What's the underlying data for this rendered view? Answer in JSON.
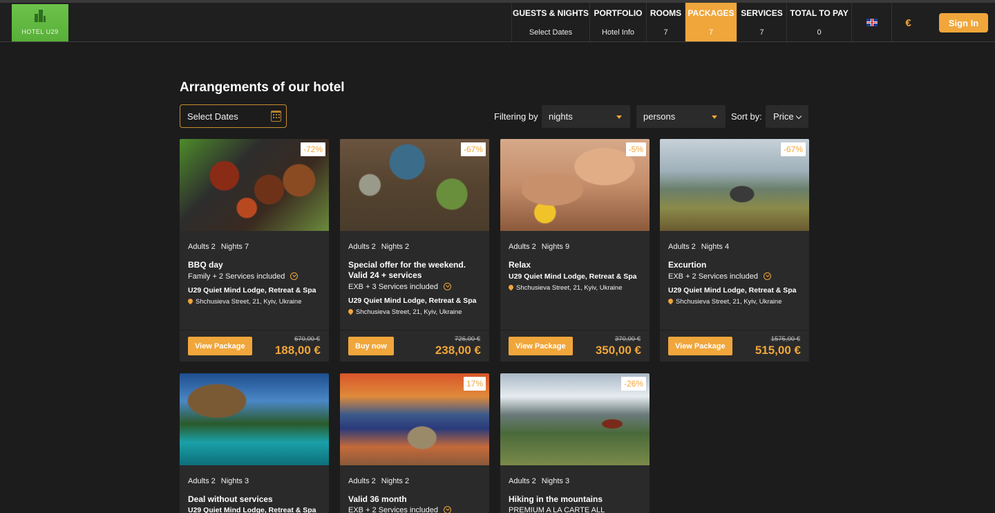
{
  "logo": {
    "text": "HOTEL U29"
  },
  "nav": {
    "guests": {
      "title": "GUESTS & NIGHTS",
      "value": "Select Dates"
    },
    "portfolio": {
      "title": "PORTFOLIO",
      "value": "Hotel Info"
    },
    "rooms": {
      "title": "ROOMS",
      "value": "7"
    },
    "packages": {
      "title": "PACKAGES",
      "value": "7"
    },
    "services": {
      "title": "SERVICES",
      "value": "7"
    },
    "total": {
      "title": "TOTAL TO PAY",
      "value": "0"
    },
    "language_icon": "uk-flag-icon",
    "currency": "€",
    "signin": "Sign In"
  },
  "colors": {
    "accent": "#f0a63b",
    "background": "#1c1c1c",
    "card": "#2a2a2a",
    "logo_green": "#6cc24a"
  },
  "main": {
    "title": "Arrangements of our hotel",
    "date_input": "Select Dates",
    "filter_label": "Filtering by",
    "filter_nights": "nights",
    "filter_persons": "persons",
    "sort_label": "Sort by:",
    "sort_value": "Price"
  },
  "cards": [
    {
      "discount": "-72%",
      "adults": "Adults 2",
      "nights": "Nights 7",
      "title": "BBQ day",
      "subtitle": "Family + 2 Services included",
      "hotel": "U29 Quiet Mind Lodge, Retreat & Spa",
      "address": "Shchusieva Street, 21, Kyiv, Ukraine",
      "button": "View Package",
      "old_price": "670,00 €",
      "price": "188,00 €"
    },
    {
      "discount": "-67%",
      "adults": "Adults 2",
      "nights": "Nights 2",
      "title": "Special offer for the weekend. Valid 24 + services",
      "subtitle": "EXB + 3 Services included",
      "hotel": "U29 Quiet Mind Lodge, Retreat & Spa",
      "address": "Shchusieva Street, 21, Kyiv, Ukraine",
      "button": "Buy now",
      "old_price": "726,00 €",
      "price": "238,00 €"
    },
    {
      "discount": "-5%",
      "adults": "Adults 2",
      "nights": "Nights 9",
      "title": "Relax",
      "subtitle": "",
      "hotel": "U29 Quiet Mind Lodge, Retreat & Spa",
      "address": "Shchusieva Street, 21, Kyiv, Ukraine",
      "button": "View Package",
      "old_price": "370,00 €",
      "price": "350,00 €"
    },
    {
      "discount": "-67%",
      "adults": "Adults 2",
      "nights": "Nights 4",
      "title": "Excurtion",
      "subtitle": "EXB + 2 Services included",
      "hotel": "U29 Quiet Mind Lodge, Retreat & Spa",
      "address": "Shchusieva Street, 21, Kyiv, Ukraine",
      "button": "View Package",
      "old_price": "1575,00 €",
      "price": "515,00 €"
    },
    {
      "discount": "",
      "adults": "Adults 2",
      "nights": "Nights 3",
      "title": "Deal without services",
      "subtitle": "",
      "hotel": "U29 Quiet Mind Lodge, Retreat & Spa",
      "address": "",
      "button": "",
      "old_price": "",
      "price": ""
    },
    {
      "discount": "17%",
      "adults": "Adults 2",
      "nights": "Nights 2",
      "title": "Valid 36 month",
      "subtitle": "EXB + 2 Services included",
      "hotel": "",
      "address": "",
      "button": "",
      "old_price": "",
      "price": ""
    },
    {
      "discount": "-26%",
      "adults": "Adults 2",
      "nights": "Nights 3",
      "title": "Hiking in the mountains",
      "subtitle": "PREMIUM A LA CARTE ALL",
      "hotel": "",
      "address": "",
      "button": "",
      "old_price": "",
      "price": ""
    }
  ]
}
